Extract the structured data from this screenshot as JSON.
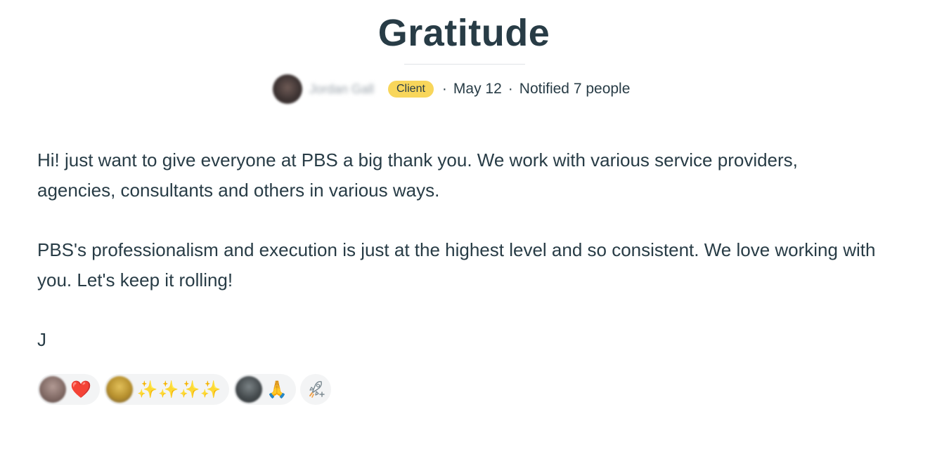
{
  "post": {
    "title": "Gratitude",
    "author_name": "Jordan Gall",
    "author_badge": "Client",
    "date": "May 12",
    "notified": "Notified 7 people",
    "separator": "·"
  },
  "body": {
    "paragraphs": [
      "Hi! just want to give everyone at PBS a big thank you. We work with various service providers, agencies, consultants and others in various ways.",
      "PBS's professionalism and execution is just at the highest level and so consistent. We love working with you. Let's keep it rolling!",
      "J"
    ]
  },
  "reactions": [
    {
      "emoji": "❤️",
      "avatar_color": "#8a7470",
      "icon": "heart-icon"
    },
    {
      "emoji": "✨✨✨✨",
      "avatar_color": "#c9a43a",
      "icon": "sparkles-icon"
    },
    {
      "emoji": "🙏",
      "avatar_color": "#3f4446",
      "icon": "folded-hands-icon"
    }
  ],
  "add_reaction_icon": "rocket-add-reaction-icon",
  "colors": {
    "text": "#283c46",
    "badge": "#f8d65b",
    "pill_bg": "#f3f4f5"
  }
}
